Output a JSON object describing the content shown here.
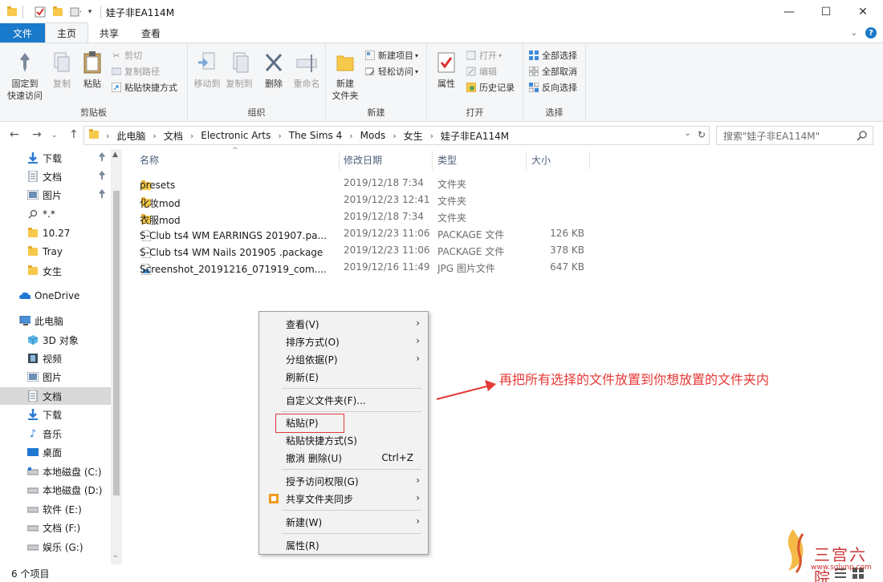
{
  "window": {
    "title": "娃子非EA114M"
  },
  "tabs": [
    {
      "label": "文件"
    },
    {
      "label": "主页"
    },
    {
      "label": "共享"
    },
    {
      "label": "查看"
    }
  ],
  "ribbon": {
    "clipboard": {
      "label": "剪贴板",
      "pin": "固定到\n快速访问",
      "pin_line1": "固定到",
      "pin_line2": "快速访问",
      "copy": "复制",
      "paste": "粘贴",
      "cut": "剪切",
      "copy_path": "复制路径",
      "paste_shortcut": "粘贴快捷方式"
    },
    "organize": {
      "label": "组织",
      "move_to": "移动到",
      "copy_to": "复制到",
      "delete": "删除",
      "rename": "重命名"
    },
    "new": {
      "label": "新建",
      "new_folder_line1": "新建",
      "new_folder_line2": "文件夹",
      "new_item": "新建项目",
      "easy_access": "轻松访问"
    },
    "open": {
      "label": "打开",
      "properties": "属性",
      "open": "打开",
      "edit": "编辑",
      "history": "历史记录"
    },
    "select": {
      "label": "选择",
      "select_all": "全部选择",
      "select_none": "全部取消",
      "invert": "反向选择"
    }
  },
  "address": {
    "crumbs": [
      "此电脑",
      "文档",
      "Electronic Arts",
      "The Sims 4",
      "Mods",
      "女生",
      "娃子非EA114M"
    ],
    "search_placeholder": "搜索\"娃子非EA114M\""
  },
  "sidebar": {
    "items": [
      {
        "label": "下载",
        "icon": "download-icon",
        "pinned": true
      },
      {
        "label": "文档",
        "icon": "document-icon",
        "pinned": true
      },
      {
        "label": "图片",
        "icon": "picture-icon",
        "pinned": true
      },
      {
        "label": "*.*",
        "icon": "search-icon"
      },
      {
        "label": "10.27",
        "icon": "folder-icon"
      },
      {
        "label": "Tray",
        "icon": "folder-icon"
      },
      {
        "label": "女生",
        "icon": "folder-icon"
      },
      {
        "label": "OneDrive",
        "icon": "cloud-icon"
      },
      {
        "label": "此电脑",
        "icon": "computer-icon"
      },
      {
        "label": "3D 对象",
        "icon": "cube-icon"
      },
      {
        "label": "视频",
        "icon": "video-icon"
      },
      {
        "label": "图片",
        "icon": "picture-icon"
      },
      {
        "label": "文档",
        "icon": "document-icon"
      },
      {
        "label": "下载",
        "icon": "download-icon"
      },
      {
        "label": "音乐",
        "icon": "music-icon"
      },
      {
        "label": "桌面",
        "icon": "desktop-icon"
      },
      {
        "label": "本地磁盘 (C:)",
        "icon": "drive-icon"
      },
      {
        "label": "本地磁盘 (D:)",
        "icon": "drive-icon"
      },
      {
        "label": "软件 (E:)",
        "icon": "drive-icon"
      },
      {
        "label": "文档 (F:)",
        "icon": "drive-icon"
      },
      {
        "label": "娱乐 (G:)",
        "icon": "drive-icon"
      }
    ]
  },
  "columns": {
    "name": "名称",
    "date": "修改日期",
    "type": "类型",
    "size": "大小"
  },
  "files": [
    {
      "name": "presets",
      "date": "2019/12/18 7:34",
      "type": "文件夹",
      "size": "",
      "icon": "folder-icon"
    },
    {
      "name": "化妆mod",
      "date": "2019/12/23 12:41",
      "type": "文件夹",
      "size": "",
      "icon": "folder-icon"
    },
    {
      "name": "衣服mod",
      "date": "2019/12/18 7:34",
      "type": "文件夹",
      "size": "",
      "icon": "folder-icon"
    },
    {
      "name": "S-Club ts4 WM EARRINGS 201907.pa...",
      "date": "2019/12/23 11:06",
      "type": "PACKAGE 文件",
      "size": "126 KB",
      "icon": "file-icon"
    },
    {
      "name": "S-Club ts4 WM Nails 201905 .package",
      "date": "2019/12/23 11:06",
      "type": "PACKAGE 文件",
      "size": "378 KB",
      "icon": "file-icon"
    },
    {
      "name": "Screenshot_20191216_071919_com....",
      "date": "2019/12/16 11:49",
      "type": "JPG 图片文件",
      "size": "647 KB",
      "icon": "image-file-icon"
    }
  ],
  "context_menu": {
    "view": "查看(V)",
    "sort": "排序方式(O)",
    "group": "分组依据(P)",
    "refresh": "刷新(E)",
    "customize": "自定义文件夹(F)...",
    "paste": "粘贴(P)",
    "paste_shortcut": "粘贴快捷方式(S)",
    "undo": "撤消 删除(U)",
    "undo_shortcut": "Ctrl+Z",
    "grant_access": "授予访问权限(G)",
    "sync": "共享文件夹同步",
    "new": "新建(W)",
    "properties": "属性(R)"
  },
  "annotation": "再把所有选择的文件放置到你想放置的文件夹内",
  "status": "6 个项目",
  "watermark": {
    "text": "三宫六院",
    "url": "www.sglynp.com"
  },
  "colors": {
    "accent": "#1979ca",
    "annotation": "#e53935",
    "folder": "#f6c94b"
  }
}
